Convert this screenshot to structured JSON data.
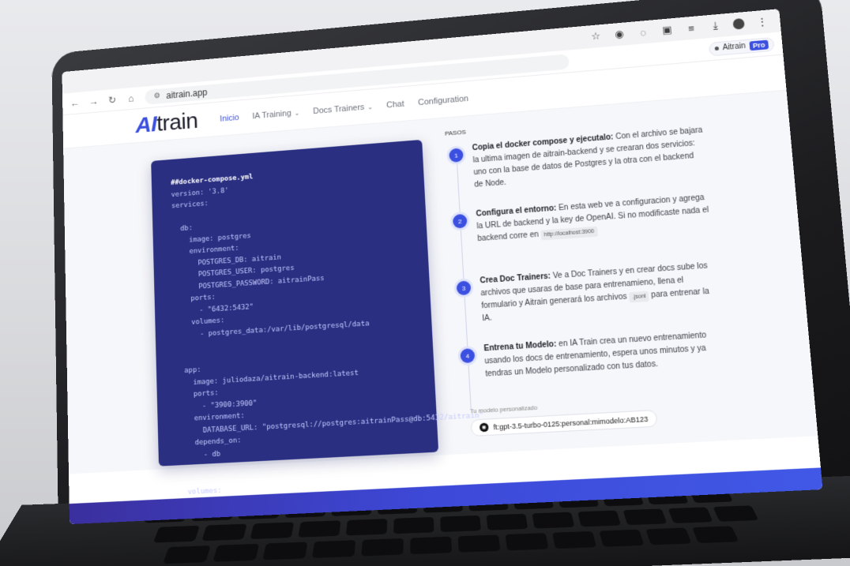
{
  "browser": {
    "url": "aitrain.app",
    "toolbar_icons": [
      "star-icon",
      "extension-icon",
      "profile-icon",
      "puzzle-icon",
      "media-icon",
      "download-icon",
      "account-icon",
      "menu-icon"
    ]
  },
  "header": {
    "logo_mark": "AI",
    "logo_text": "train",
    "nav": [
      {
        "label": "Inicio",
        "active": true,
        "dropdown": false
      },
      {
        "label": "IA Training",
        "active": false,
        "dropdown": true
      },
      {
        "label": "Docs Trainers",
        "active": false,
        "dropdown": true
      },
      {
        "label": "Chat",
        "active": false,
        "dropdown": false
      },
      {
        "label": "Configuration",
        "active": false,
        "dropdown": false
      }
    ],
    "plan": {
      "label": "Aitrain",
      "badge": "Pro"
    }
  },
  "code": {
    "first_line": "##docker-compose.yml",
    "body": "version: '3.8'\nservices:\n\n  db:\n    image: postgres\n    environment:\n      POSTGRES_DB: aitrain\n      POSTGRES_USER: postgres\n      POSTGRES_PASSWORD: aitrainPass\n    ports:\n      - \"6432:5432\"\n    volumes:\n      - postgres_data:/var/lib/postgresql/data\n\n\n  app:\n    image: juliodaza/aitrain-backend:latest\n    ports:\n      - \"3900:3900\"\n    environment:\n      DATABASE_URL: \"postgresql://postgres:aitrainPass@db:5432/aitrain\"\n    depends_on:\n      - db\n\n\n  volumes:\n    postgres_data:"
  },
  "steps": {
    "title": "PASOS",
    "items": [
      {
        "num": "1",
        "title": "Copia el docker compose y ejecutalo:",
        "text": "Con el archivo se bajara la ultima imagen de aitrain-backend y se crearan dos servicios: uno con la base de datos de Postgres y la otra con el backend de Node."
      },
      {
        "num": "2",
        "title": "Configura el entorno:",
        "text": "En esta web ve a configuracion y agrega la URL de backend y la key de OpenAI. Si no modificaste nada el backend corre en",
        "chip": "http://localhost:3900"
      },
      {
        "num": "3",
        "title": "Crea Doc Trainers:",
        "text": "Ve a Doc Trainers y en crear docs sube los archivos que usaras de base para entrenamieno, llena el formulario y Aitrain generará los archivos",
        "chip": ".jsonl",
        "text_after": "para entrenar la IA."
      },
      {
        "num": "4",
        "title": "Entrena tu Modelo:",
        "text": "en IA Train crea un nuevo entrenamiento usando los docs de entrenamiento, espera unos minutos y ya tendras un Modelo personalizado con tus datos."
      }
    ],
    "model_label": "Tu modelo personalizado",
    "model_value": "ft:gpt-3.5-turbo-0125:personal:mimodelo:AB123"
  },
  "colors": {
    "accent": "#3b4fe0",
    "code_bg": "#2a2f82",
    "band": "#3d49d8"
  }
}
